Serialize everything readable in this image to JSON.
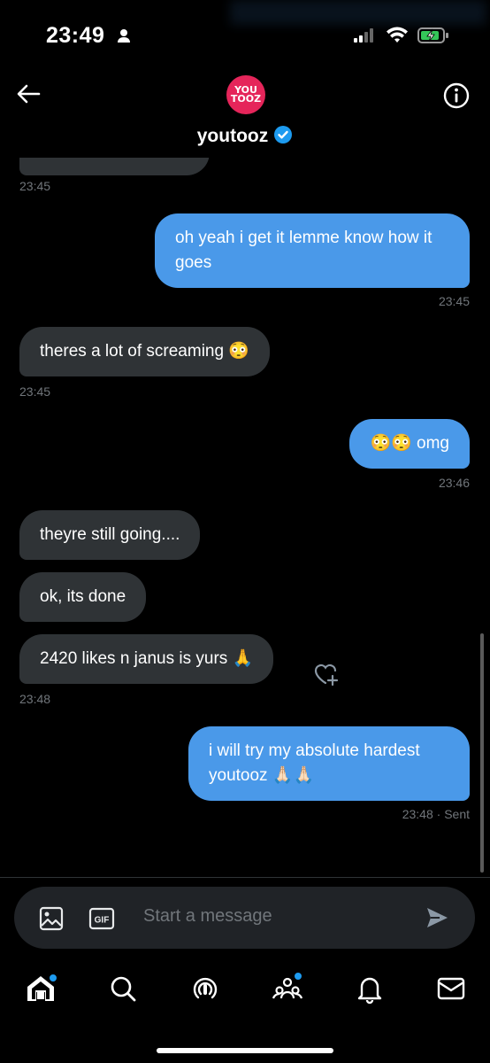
{
  "status_bar": {
    "time": "23:49"
  },
  "header": {
    "avatar_text": [
      "YOU",
      "TOOZ"
    ],
    "name": "youtooz"
  },
  "messages": [
    {
      "dir": "out",
      "text": "oh yeah i get it lemme know how it goes",
      "time": "23:45"
    },
    {
      "dir": "in",
      "text": "theres a lot of screaming 😳",
      "time": "23:45"
    },
    {
      "dir": "out",
      "text": "😳😳 omg",
      "time": "23:46"
    },
    {
      "dir": "in",
      "text": "theyre still going...."
    },
    {
      "dir": "in",
      "text": "ok, its done"
    },
    {
      "dir": "in",
      "text": "2420 likes n janus is yurs 🙏",
      "time": "23:48"
    },
    {
      "dir": "out",
      "text": "i will try my absolute hardest youtooz 🙏🏻🙏🏻",
      "time": "23:48 · Sent"
    }
  ],
  "top_partial_time": "23:45",
  "composer": {
    "placeholder": "Start a message",
    "gif_label": "GIF"
  },
  "tabs": [
    "home",
    "search",
    "spaces",
    "communities",
    "notifications",
    "messages"
  ],
  "colors": {
    "accent": "#1d9bf0",
    "bubble_out": "#4a99e9",
    "bubble_in": "#2f3336",
    "avatar": "#e5255a"
  }
}
